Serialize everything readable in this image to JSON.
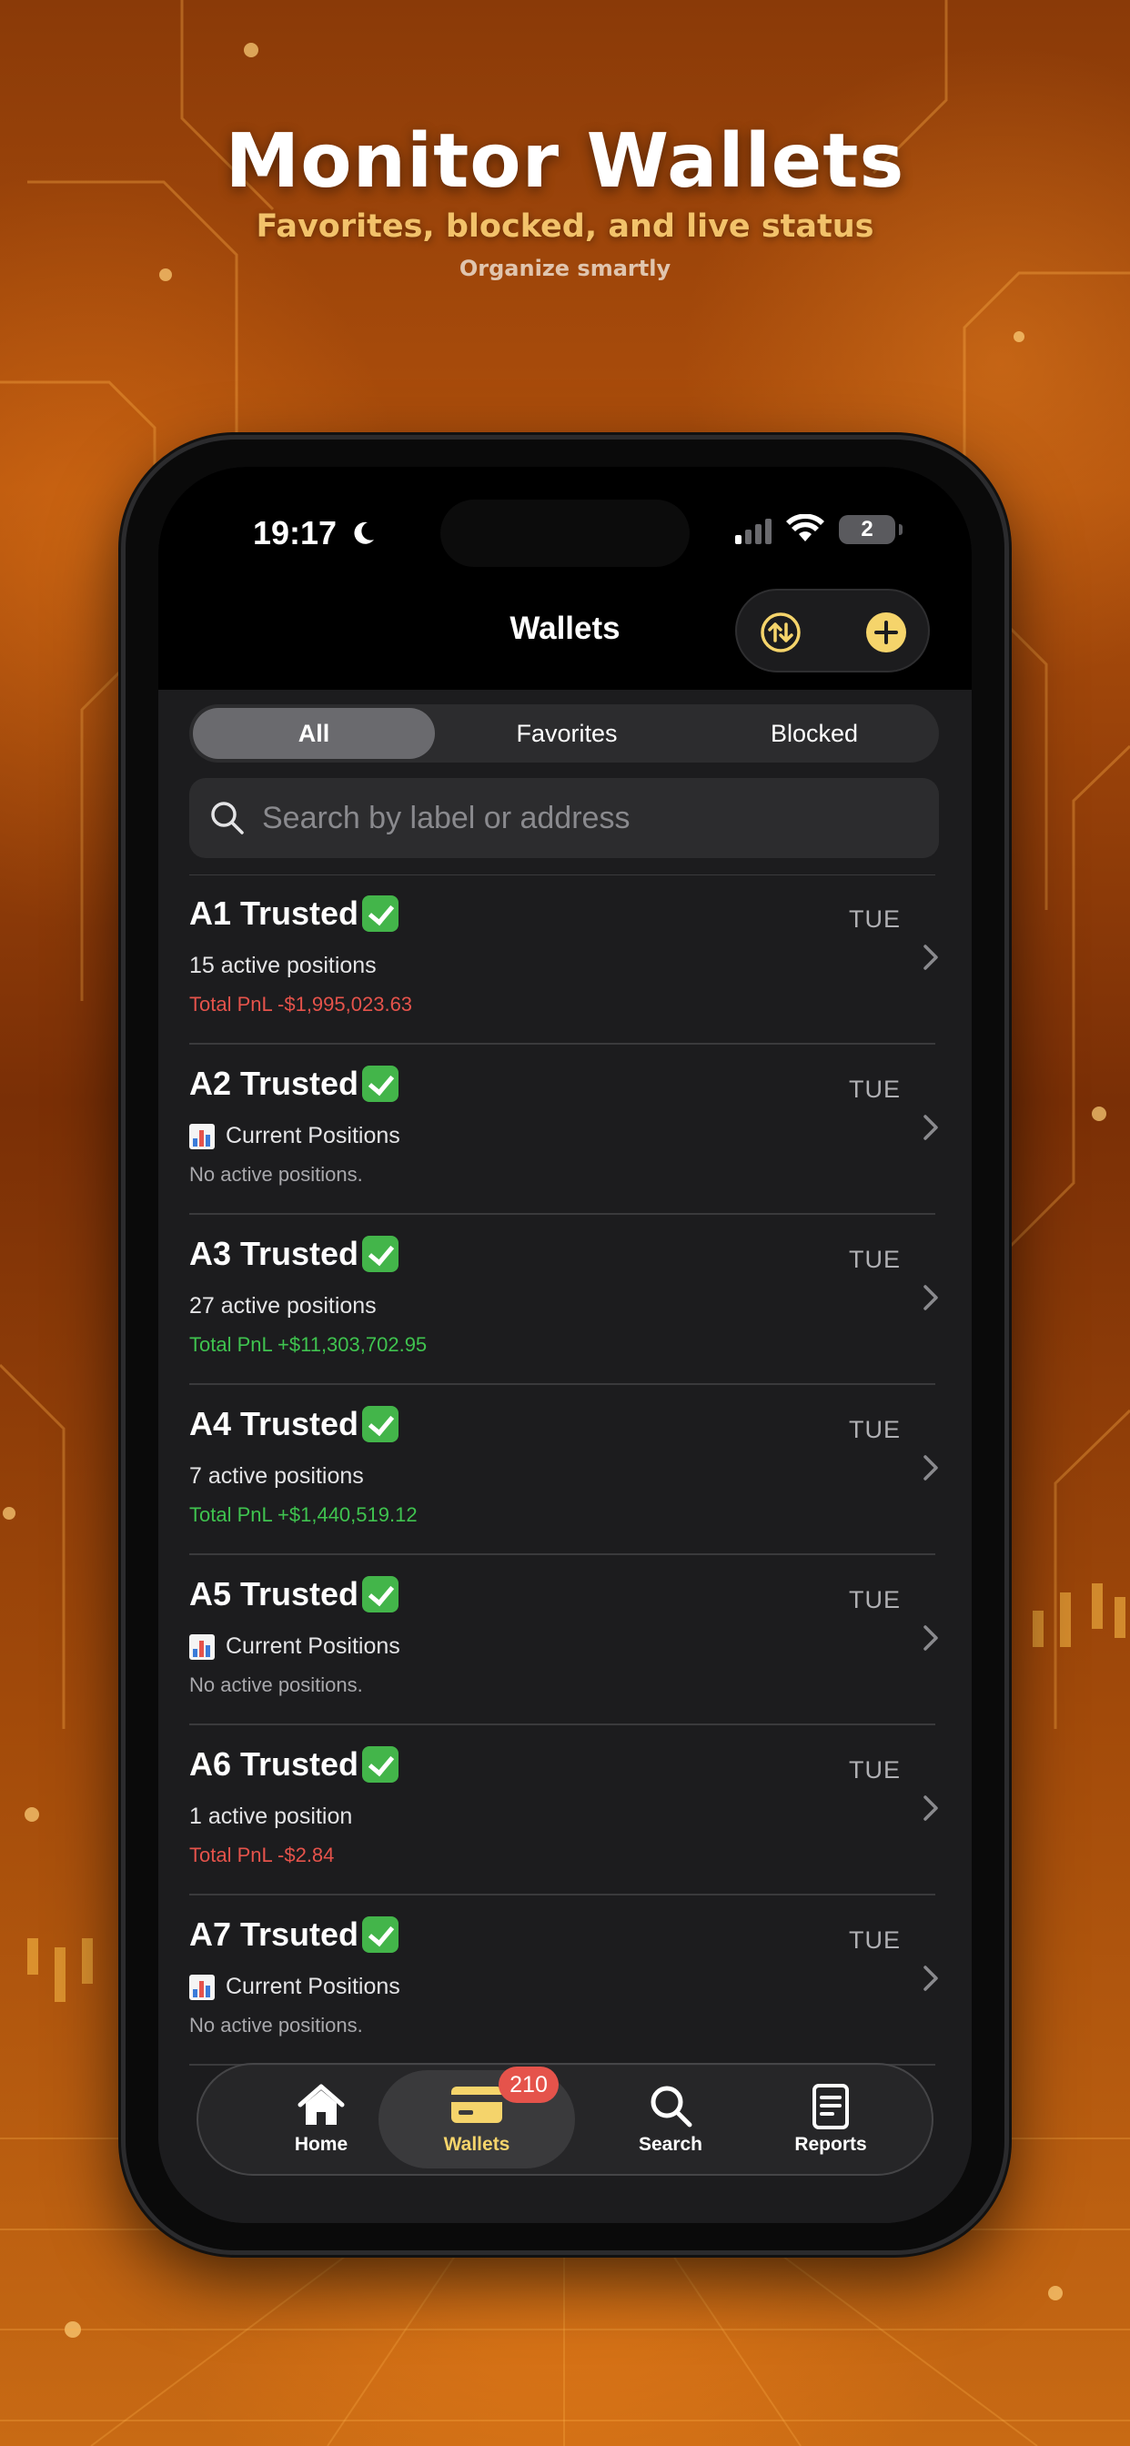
{
  "hero": {
    "title": "Monitor Wallets",
    "subtitle": "Favorites, blocked, and live status",
    "tagline": "Organize smartly"
  },
  "status_bar": {
    "time": "19:17",
    "battery": "2"
  },
  "header": {
    "title": "Wallets"
  },
  "segments": [
    {
      "label": "All",
      "active": true
    },
    {
      "label": "Favorites",
      "active": false
    },
    {
      "label": "Blocked",
      "active": false
    }
  ],
  "search": {
    "placeholder": "Search by label or address"
  },
  "wallets": [
    {
      "label": "A1 Trusted",
      "day": "TUE",
      "line2": "15 active positions",
      "line3": "Total PnL -$1,995,023.63",
      "kind": "neg"
    },
    {
      "label": "A2 Trusted",
      "day": "TUE",
      "line2": "Current Positions",
      "line3": "No active positions.",
      "kind": "none"
    },
    {
      "label": "A3 Trusted",
      "day": "TUE",
      "line2": "27 active positions",
      "line3": "Total PnL +$11,303,702.95",
      "kind": "pos"
    },
    {
      "label": "A4 Trusted",
      "day": "TUE",
      "line2": "7 active positions",
      "line3": "Total PnL +$1,440,519.12",
      "kind": "pos"
    },
    {
      "label": "A5 Trusted",
      "day": "TUE",
      "line2": "Current Positions",
      "line3": "No active positions.",
      "kind": "none"
    },
    {
      "label": "A6 Trusted",
      "day": "TUE",
      "line2": "1 active position",
      "line3": "Total PnL -$2.84",
      "kind": "neg"
    },
    {
      "label": "A7 Trsuted",
      "day": "TUE",
      "line2": "Current Positions",
      "line3": "No active positions.",
      "kind": "none"
    }
  ],
  "tabbar": {
    "items": [
      {
        "label": "Home",
        "icon": "house-icon"
      },
      {
        "label": "Wallets",
        "icon": "wallet-card-icon",
        "badge": "210",
        "active": true
      },
      {
        "label": "Search",
        "icon": "magnifier-icon"
      },
      {
        "label": "Reports",
        "icon": "document-icon"
      }
    ]
  },
  "colors": {
    "accent": "#f5d46b",
    "negative": "#e5534b",
    "positive": "#3fc34f",
    "check": "#43b54a"
  }
}
